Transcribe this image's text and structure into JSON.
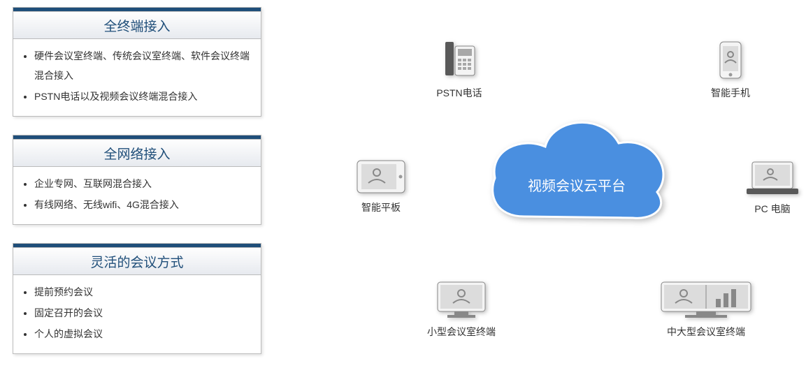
{
  "panels": [
    {
      "title": "全终端接入",
      "items": [
        "硬件会议室终端、传统会议室终端、软件会议终端混合接入",
        "PSTN电话以及视频会议终端混合接入"
      ]
    },
    {
      "title": "全网络接入",
      "items": [
        "企业专网、互联网混合接入",
        "有线网络、无线wifi、4G混合接入"
      ]
    },
    {
      "title": "灵活的会议方式",
      "items": [
        "提前预约会议",
        "固定召开的会议",
        "个人的虚拟会议"
      ]
    }
  ],
  "cloud_label": "视频会议云平台",
  "nodes": {
    "phone": "PSTN电话",
    "smart": "智能手机",
    "tablet": "智能平板",
    "pc": "PC 电脑",
    "small": "小型会议室终端",
    "large": "中大型会议室终端"
  }
}
